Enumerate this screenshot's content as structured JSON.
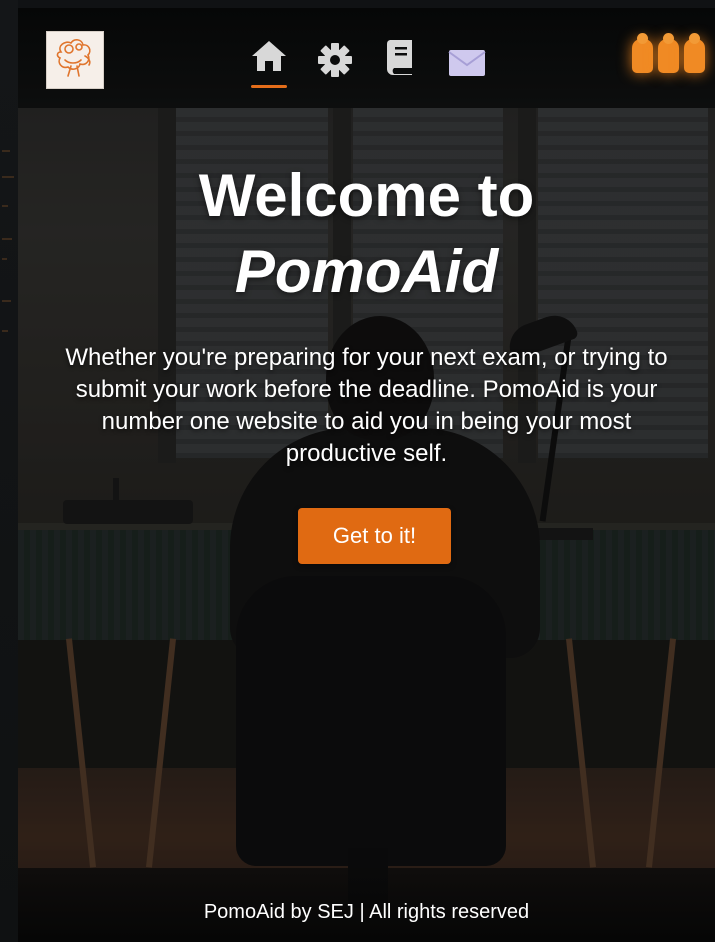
{
  "header": {
    "nav": [
      {
        "icon": "home-icon",
        "active": true
      },
      {
        "icon": "gear-icon",
        "active": false
      },
      {
        "icon": "book-icon",
        "active": false
      },
      {
        "icon": "mail-icon",
        "active": false
      }
    ],
    "pomodoro_count": 3,
    "accent_color": "#e46d1a"
  },
  "hero": {
    "title_line1": "Welcome to",
    "title_line2": "PomoAid",
    "text": "Whether you're preparing for your next exam, or trying to submit your work before the deadline. PomoAid is your number one website to aid you in being your most productive self.",
    "cta_label": "Get to it!",
    "cta_color": "#e06a12"
  },
  "footer": {
    "text": "PomoAid by SEJ | All rights reserved"
  }
}
